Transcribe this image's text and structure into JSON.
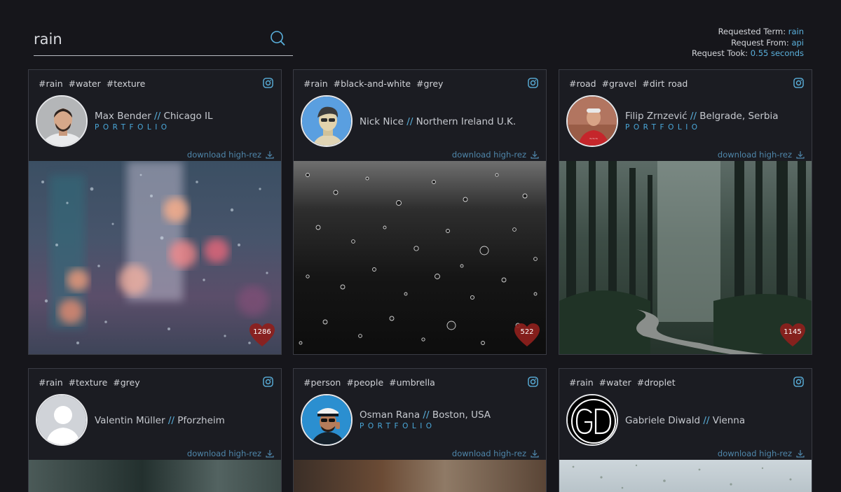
{
  "search": {
    "value": "rain"
  },
  "request_info": {
    "term_label": "Requested Term: ",
    "term_value": "rain",
    "from_label": "Request From: ",
    "from_value": "api",
    "took_label": "Request Took: ",
    "took_value": "0.55 seconds"
  },
  "cards": [
    {
      "tags": [
        "#rain",
        "#water",
        "#texture"
      ],
      "author": "Max Bender",
      "location": "Chicago IL",
      "separator": "//",
      "portfolio": "PORTFOLIO",
      "download": "download high-rez",
      "likes": "1286"
    },
    {
      "tags": [
        "#rain",
        "#black-and-white",
        "#grey"
      ],
      "author": "Nick Nice",
      "location": "Northern Ireland U.K.",
      "separator": "//",
      "download": "download high-rez",
      "likes": "522"
    },
    {
      "tags": [
        "#road",
        "#gravel",
        "#dirt road"
      ],
      "author": "Filip Zrnzević",
      "location": "Belgrade, Serbia",
      "separator": "//",
      "portfolio": "PORTFOLIO",
      "download": "download high-rez",
      "likes": "1145"
    },
    {
      "tags": [
        "#rain",
        "#texture",
        "#grey"
      ],
      "author": "Valentin Müller",
      "location": "Pforzheim",
      "separator": "//",
      "download": "download high-rez"
    },
    {
      "tags": [
        "#person",
        "#people",
        "#umbrella"
      ],
      "author": "Osman Rana",
      "location": "Boston, USA",
      "separator": "//",
      "portfolio": "PORTFOLIO",
      "download": "download high-rez"
    },
    {
      "tags": [
        "#rain",
        "#water",
        "#droplet"
      ],
      "author": "Gabriele Diwald",
      "location": "Vienna",
      "separator": "//",
      "download": "download high-rez"
    }
  ],
  "colors": {
    "background": "#16161b",
    "card": "#1b1c22",
    "accent": "#5ab0dc",
    "heart": "#8e1f1c"
  },
  "icons": {
    "search": "search-icon",
    "instagram": "instagram-icon",
    "download": "download-icon",
    "heart": "heart-icon"
  }
}
